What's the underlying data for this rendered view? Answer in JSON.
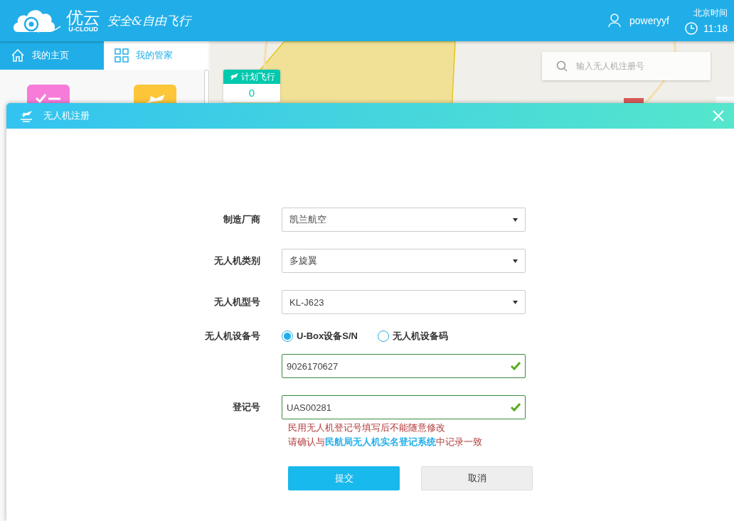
{
  "header": {
    "logo_title": "优云",
    "logo_sub": "U-CLOUD",
    "slogan": "安全&自由飞行",
    "user": "poweryyf",
    "time_label": "北京时间",
    "time": "11:18"
  },
  "nav_tabs": [
    {
      "label": "我的主页",
      "selected": true,
      "kind": "home"
    },
    {
      "label": "我的管家",
      "selected": false,
      "kind": "grid"
    }
  ],
  "tiles": [
    {
      "kind": "check",
      "color": "#f77bd9"
    },
    {
      "kind": "plane",
      "color": "#fdc639"
    }
  ],
  "flight_card": {
    "title": "计划飞行",
    "count": "0"
  },
  "search": {
    "placeholder": "输入无人机注册号"
  },
  "dialog": {
    "title": "无人机注册",
    "fields": [
      {
        "kind": "select",
        "label": "制造厂商",
        "value": "凯兰航空"
      },
      {
        "kind": "select",
        "label": "无人机类别",
        "value": "多旋翼"
      },
      {
        "kind": "select",
        "label": "无人机型号",
        "value": "KL-J623"
      },
      {
        "kind": "radio",
        "label": "无人机设备号",
        "options": [
          {
            "label": "U-Box设备S/N",
            "selected": true
          },
          {
            "label": "无人机设备码",
            "selected": false
          }
        ],
        "value": "9026170627",
        "valid": true
      },
      {
        "kind": "text",
        "label": "登记号",
        "value": "UAS00281",
        "valid": true
      }
    ],
    "notes": [
      {
        "text": "民用无人机登记号填写后不能随意修改"
      },
      {
        "text": "请确认与",
        "link": "民航局无人机实名登记系统",
        "after": "中记录一致"
      }
    ],
    "buttons": [
      {
        "label": "提交",
        "kind": "primary"
      },
      {
        "label": "取消",
        "kind": "secondary"
      }
    ]
  }
}
